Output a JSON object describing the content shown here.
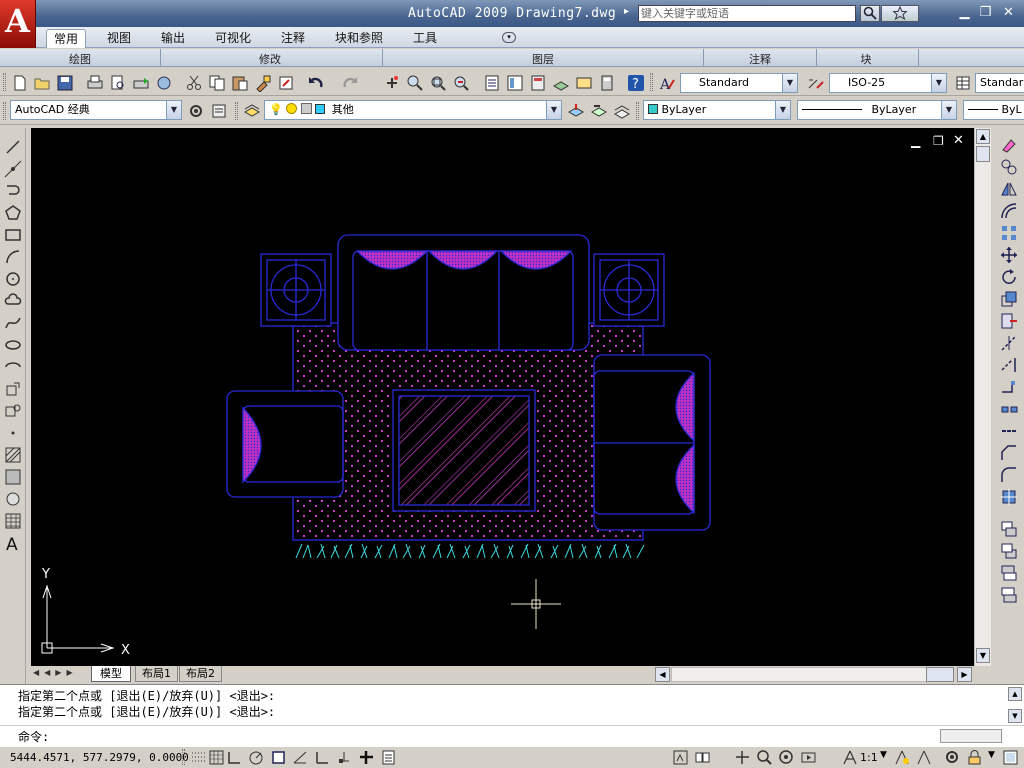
{
  "window": {
    "title": "AutoCAD 2009  Drawing7.dwg",
    "app_logo_letter": "A",
    "search_placeholder": "键入关键字或短语"
  },
  "ribbon": {
    "tabs": [
      "常用",
      "视图",
      "输出",
      "可视化",
      "注释",
      "块和参照",
      "工具"
    ],
    "active_tab": "常用",
    "panels": [
      "绘图",
      "修改",
      "图层",
      "注释",
      "块"
    ]
  },
  "toolbar1": {
    "text_style": "Standard",
    "dim_style": "ISO-25",
    "table_style": "Standar"
  },
  "toolbar2": {
    "workspace": "AutoCAD 经典",
    "layer": "其他",
    "color": "ByLayer",
    "linetype": "ByLayer",
    "lineweight": "ByL"
  },
  "layout_tabs": [
    "模型",
    "布局1",
    "布局2"
  ],
  "active_layout": "模型",
  "ucs": {
    "x_label": "X",
    "y_label": "Y"
  },
  "command": {
    "history": [
      "指定第二个点或 [退出(E)/放弃(U)] <退出>:",
      "指定第二个点或 [退出(E)/放弃(U)] <退出>:"
    ],
    "prompt": "命令:"
  },
  "status": {
    "coordinates": "5444.4571, 577.2979, 0.0000",
    "annotation_scale": "1:1"
  },
  "colors": {
    "canvas": "#000000",
    "furniture": "#2a2ad6",
    "hatch": "#e040e0",
    "grass": "#3fd8e0"
  }
}
